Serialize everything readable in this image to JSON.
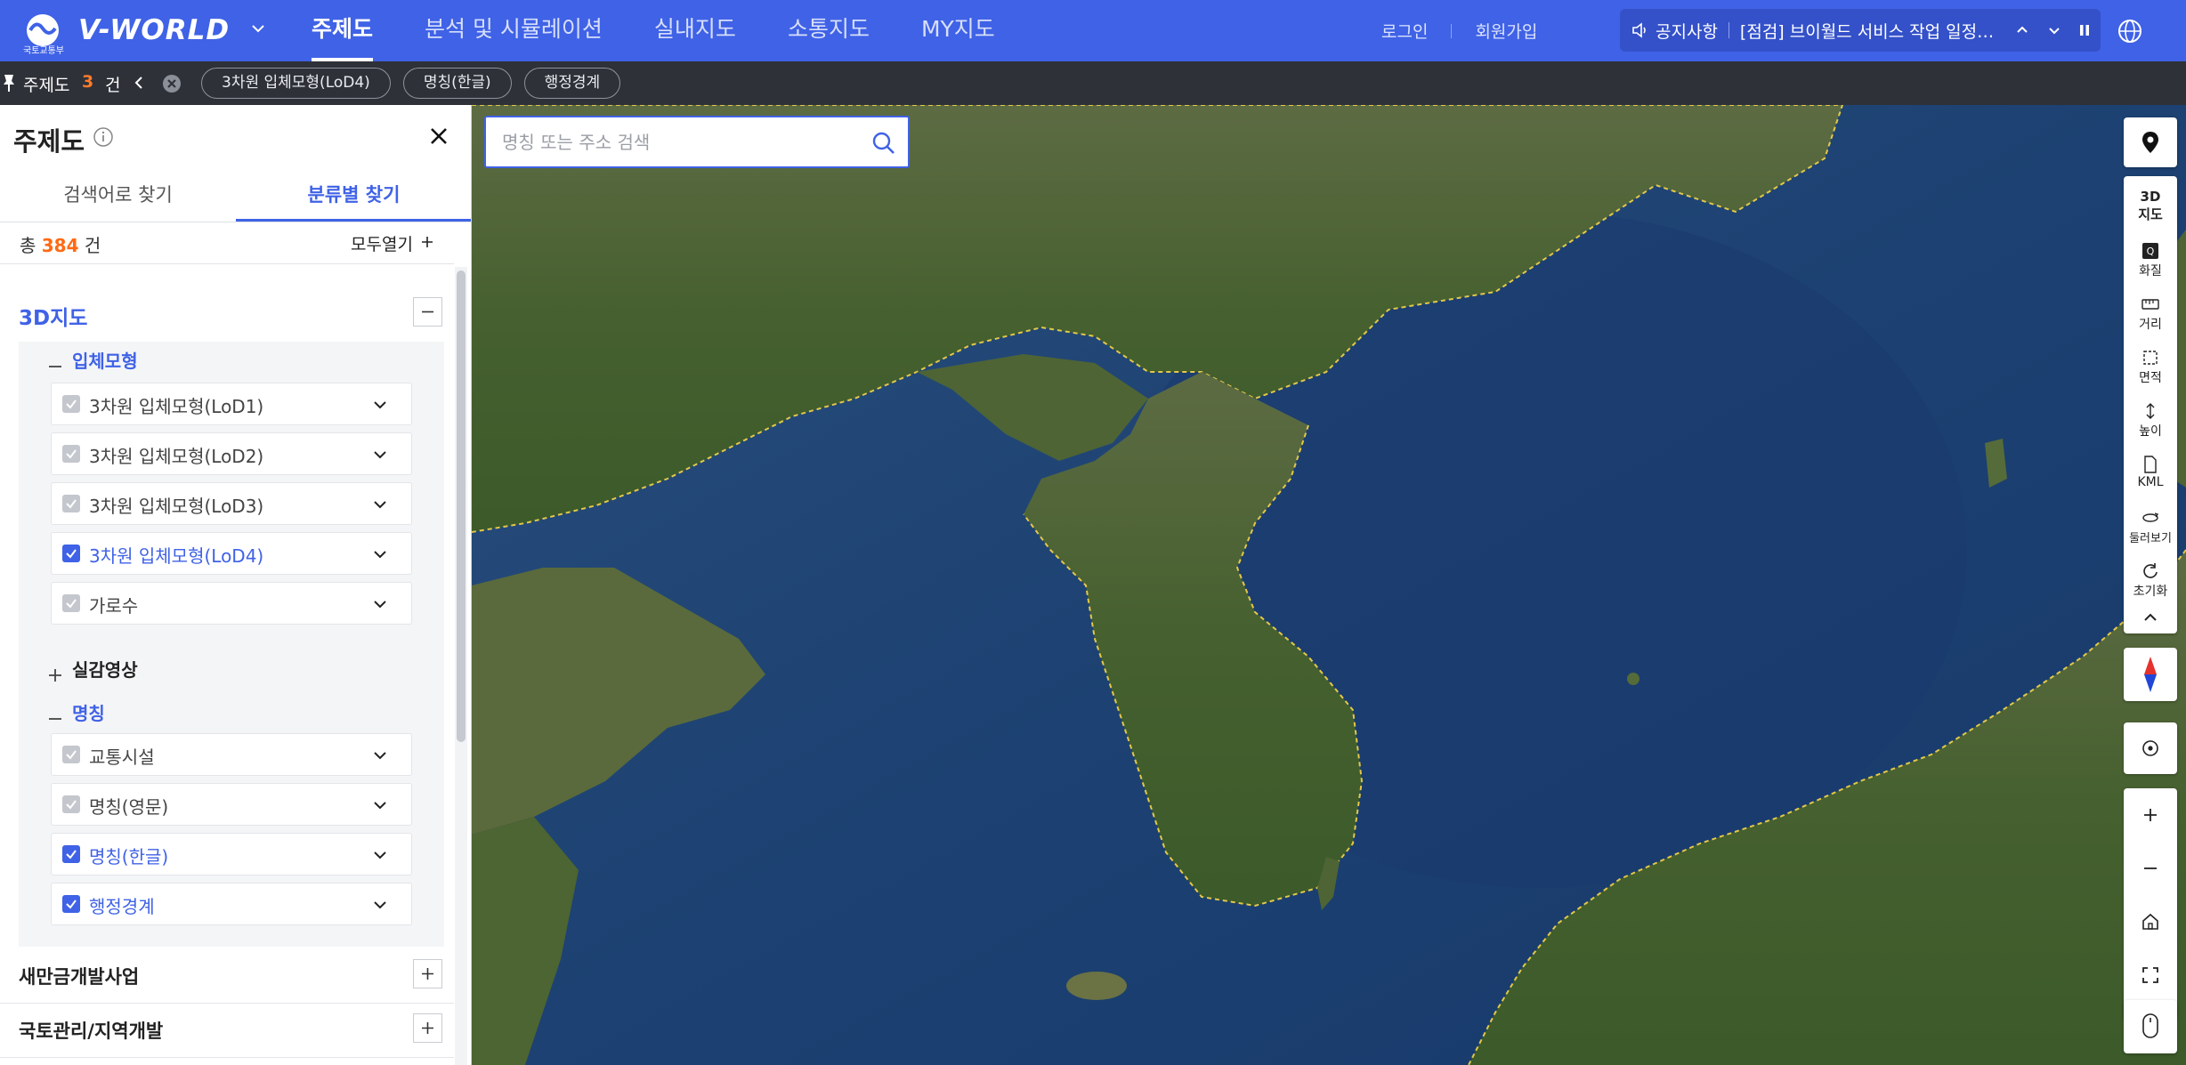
{
  "header": {
    "emblem_text": "국토교통부",
    "logo": "V-WORLD",
    "nav": [
      "주제도",
      "분석 및 시뮬레이션",
      "실내지도",
      "소통지도",
      "MY지도"
    ],
    "login": "로그인",
    "signup": "회원가입",
    "notice_label": "공지사항",
    "notice_text": "[점검] 브이월드 서비스 작업 일정 안내"
  },
  "subbar": {
    "title": "주제도",
    "count": "3",
    "unit": "건",
    "chips": [
      "3차원 입체모형(LoD4)",
      "명칭(한글)",
      "행정경계"
    ]
  },
  "panel": {
    "title": "주제도",
    "tabs": [
      "검색어로 찾기",
      "분류별 찾기"
    ],
    "total_prefix": "총",
    "total_count": "384",
    "total_unit": "건",
    "open_all": "모두열기",
    "category_3d": "3D지도",
    "group_model": "입체모형",
    "model_items": [
      {
        "label": "3차원 입체모형(LoD1)",
        "checked": false
      },
      {
        "label": "3차원 입체모형(LoD2)",
        "checked": false
      },
      {
        "label": "3차원 입체모형(LoD3)",
        "checked": false
      },
      {
        "label": "3차원 입체모형(LoD4)",
        "checked": true
      },
      {
        "label": "가로수",
        "checked": false
      }
    ],
    "group_real": "실감영상",
    "group_name": "명칭",
    "name_items": [
      {
        "label": "교통시설",
        "checked": false
      },
      {
        "label": "명칭(영문)",
        "checked": false
      },
      {
        "label": "명칭(한글)",
        "checked": true
      },
      {
        "label": "행정경계",
        "checked": true
      }
    ],
    "category_2": "새만금개발사업",
    "category_3": "국토관리/지역개발"
  },
  "map": {
    "search_placeholder": "명칭 또는 주소 검색"
  },
  "tools": {
    "mode": [
      "3D",
      "지도"
    ],
    "items": [
      "화질",
      "거리",
      "면적",
      "높이",
      "KML",
      "둘러보기",
      "초기화"
    ]
  },
  "colors": {
    "brand": "#3f62e6",
    "count_accent": "#ff6a13",
    "subbar_bg": "#2e3138"
  }
}
